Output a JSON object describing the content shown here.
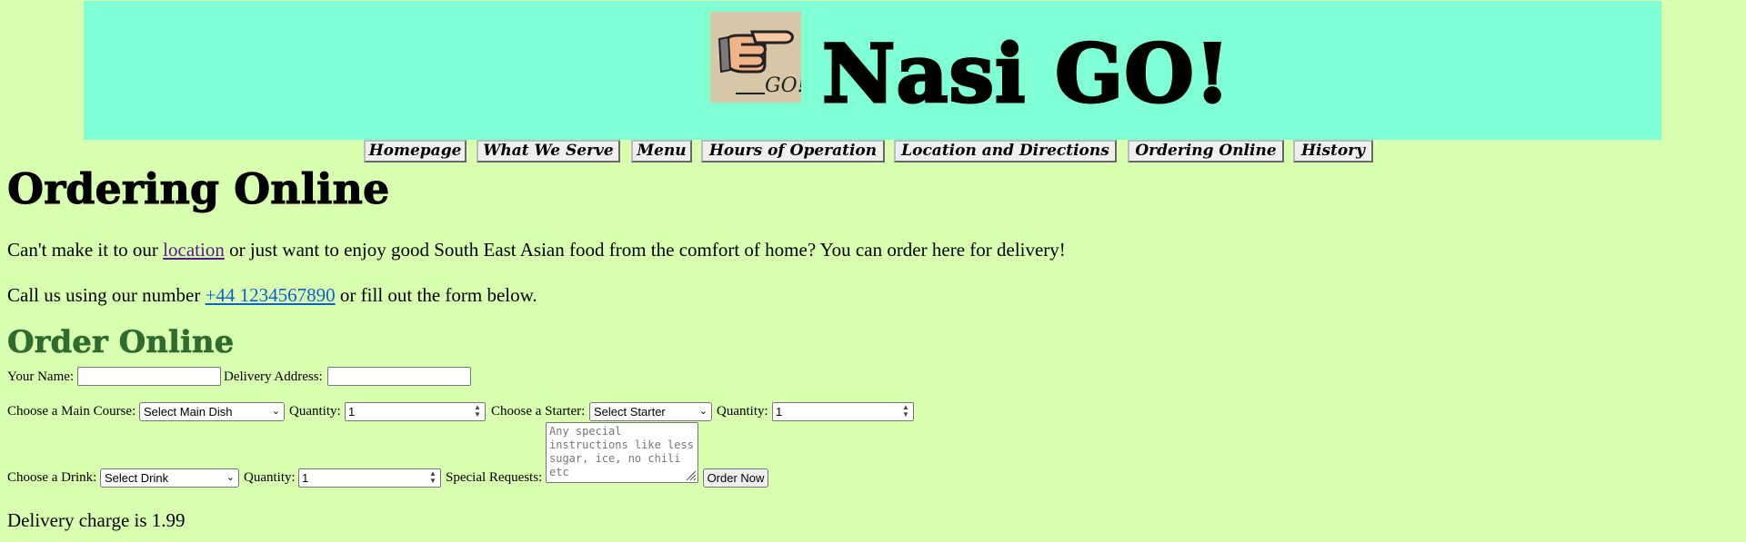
{
  "header": {
    "title": "Nasi GO!",
    "logo_text": "GO!"
  },
  "nav": {
    "items": [
      {
        "label": "Homepage"
      },
      {
        "label": "What We Serve"
      },
      {
        "label": "Menu"
      },
      {
        "label": "Hours of Operation"
      },
      {
        "label": "Location and Directions"
      },
      {
        "label": "Ordering Online"
      },
      {
        "label": "History"
      }
    ]
  },
  "page": {
    "title": "Ordering Online",
    "intro_before": "Can't make it to our ",
    "intro_link": "location",
    "intro_after": " or just want to enjoy good South East Asian food from the comfort of home? You can order here for delivery!",
    "call_before": "Call us using our number ",
    "call_link": "+44 1234567890",
    "call_after": " or fill out the form below."
  },
  "form": {
    "title": "Order Online",
    "name_label": "Your Name:",
    "name_value": "",
    "address_label": "Delivery Address:",
    "address_value": "",
    "main_label": "Choose a Main Course:",
    "main_selected": "Select Main Dish",
    "main_qty_label": "Quantity:",
    "main_qty": "1",
    "starter_label": "Choose a Starter:",
    "starter_selected": "Select Starter",
    "starter_qty_label": "Quantity:",
    "starter_qty": "1",
    "drink_label": "Choose a Drink:",
    "drink_selected": "Select Drink",
    "drink_qty_label": "Quantity:",
    "drink_qty": "1",
    "requests_label": "Special Requests:",
    "requests_placeholder": "Any special instructions like less sugar, ice, no chili etc",
    "submit_label": "Order Now"
  },
  "footer": {
    "delivery_text": "Delivery charge is 1.99"
  },
  "colors": {
    "background": "#d9ffb0",
    "banner": "#80ffd4",
    "form_title": "#2e6b2e",
    "visited_link": "#551a8b",
    "link": "#0b5fd1"
  },
  "icons": [
    "pointing-hand-icon",
    "chevron-down-icon",
    "spin-arrows-icon",
    "resize-grip-icon"
  ]
}
